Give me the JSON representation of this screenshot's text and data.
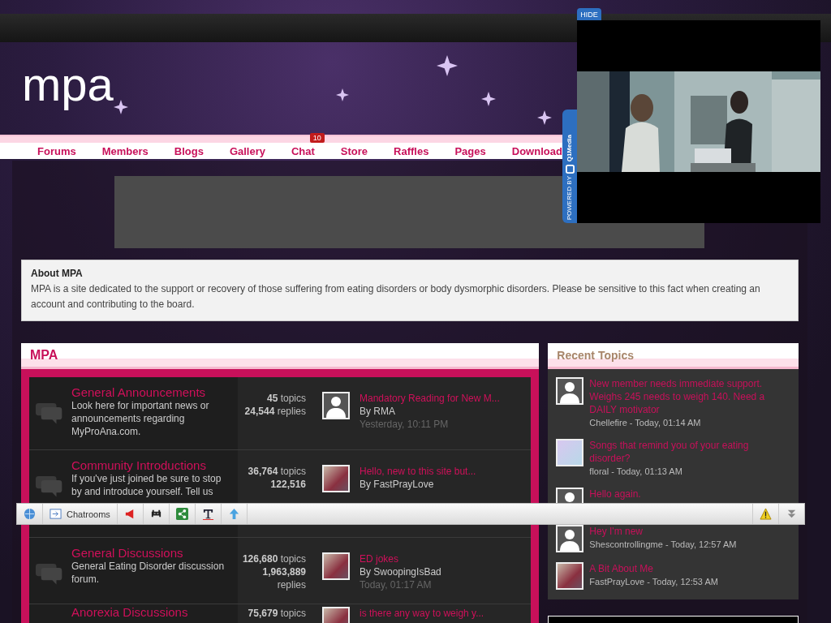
{
  "site": {
    "logo": "mpa"
  },
  "nav": [
    {
      "label": "Forums"
    },
    {
      "label": "Members"
    },
    {
      "label": "Blogs"
    },
    {
      "label": "Gallery"
    },
    {
      "label": "Chat",
      "badge": "10"
    },
    {
      "label": "Store"
    },
    {
      "label": "Raffles"
    },
    {
      "label": "Pages"
    },
    {
      "label": "Download"
    }
  ],
  "about": {
    "title": "About MPA",
    "text": "MPA is a site dedicated to the support or recovery of those suffering from eating disorders or body dysmorphic disorders. Please be sensitive to this fact when creating an account and contributing to the board."
  },
  "category": {
    "title": "MPA",
    "forums": [
      {
        "name": "General Announcements",
        "description": "Look here for important news or announcements regarding MyProAna.com.",
        "stats": [
          {
            "num": "45",
            "unit": "topics"
          },
          {
            "num": "24,544",
            "unit": "replies"
          }
        ],
        "last": {
          "avatar": {
            "kind": "silhouette"
          },
          "title": "Mandatory Reading for New M...",
          "by": "By RMA",
          "time": "Yesterday, 10:11 PM"
        }
      },
      {
        "name": "Community Introductions",
        "description": "If you've just joined be sure to stop by and introduce yourself. Tell us",
        "stats": [
          {
            "num": "36,764",
            "unit": "topics"
          },
          {
            "num": "122,516"
          }
        ],
        "last": {
          "title": "Hello, new to this site but...",
          "by": "By FastPrayLove"
        }
      },
      {
        "name": "General Discussions",
        "description": "General Eating Disorder discussion forum.",
        "stats": [
          {
            "num": "126,680",
            "unit": "topics"
          },
          {
            "num": "1,963,889",
            "unit": "replies"
          }
        ],
        "last": {
          "title": "ED jokes",
          "by": "By SwoopingIsBad",
          "time": "Today, 01:17 AM"
        }
      },
      {
        "name": "Anorexia Discussions",
        "stats": [
          {
            "num": "75,679",
            "unit": "topics"
          }
        ],
        "last": {
          "title": "is there any way to weigh y..."
        }
      }
    ]
  },
  "recent": {
    "title": "Recent Topics",
    "items": [
      {
        "avatar": {
          "kind": "silhouette"
        },
        "title": "New member needs immediate support. Weighs 245 needs to weigh 140. Need a DAILY motivator",
        "meta": "Chellefire - Today, 01:14 AM"
      },
      {
        "avatar": {
          "kind": "cartoon"
        },
        "title": "Songs that remind you of your eating disorder?",
        "meta": "floral - Today, 01:13 AM"
      },
      {
        "avatar": {
          "kind": "silhouette"
        },
        "title": "Hello again."
      },
      {
        "avatar": {
          "kind": "silhouette"
        },
        "title": "Hey I'm new",
        "meta": "Shescontrollingme - Today, 12:57 AM"
      },
      {
        "title": "A Bit About Me",
        "meta": "FastPrayLove - Today, 12:53 AM"
      }
    ]
  },
  "toolbar": {
    "items": [
      {
        "kind": "globe"
      },
      {
        "kind": "chat",
        "label": "Chatrooms"
      },
      {
        "kind": "megaphone"
      },
      {
        "kind": "invader"
      },
      {
        "kind": "share"
      },
      {
        "kind": "text"
      },
      {
        "kind": "up"
      }
    ]
  },
  "video_ad": {
    "hide": "HIDE",
    "powered": "POWERED BY",
    "brand": "Q1Media",
    "kind": "picture"
  }
}
